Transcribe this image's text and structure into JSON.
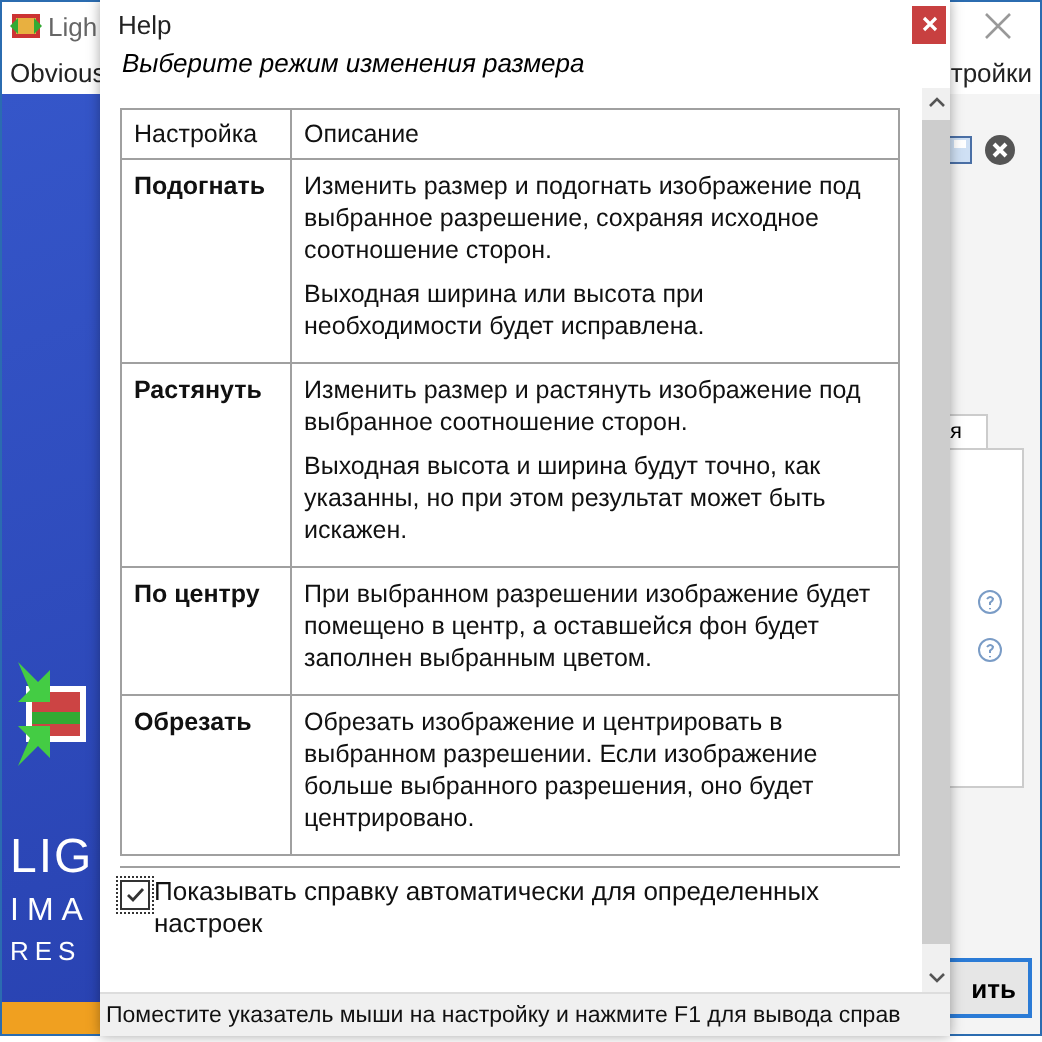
{
  "app": {
    "title": "Ligh",
    "menu_left": "Obvious",
    "menu_right": "тройки",
    "tab_fragment": "я",
    "logo_lines": [
      "LIG",
      "IMA",
      "RES"
    ],
    "button": "ить"
  },
  "dialog": {
    "title": "Help",
    "subtitle": "Выберите режим изменения размера",
    "table": {
      "columns": [
        "Настройка",
        "Описание"
      ],
      "rows": [
        {
          "setting": "Подогнать",
          "description": [
            "Изменить размер и подогнать изображение под выбранное разрешение, сохраняя исходное соотношение сторон.",
            "Выходная ширина или высота при необходимости будет исправлена."
          ]
        },
        {
          "setting": "Растянуть",
          "description": [
            "Изменить размер и растянуть изображение под выбранное соотношение сторон.",
            "Выходная высота и ширина будут точно, как указанны, но при этом результат может быть искажен."
          ]
        },
        {
          "setting": "По центру",
          "description": [
            "При выбранном разрешении изображение будет помещено в центр, а оставшейся фон будет заполнен выбранным цветом."
          ]
        },
        {
          "setting": "Обрезать",
          "description": [
            "Обрезать изображение и центрировать в выбранном разрешении. Если изображение больше выбранного разрешения, оно будет центрировано."
          ]
        }
      ]
    },
    "checkbox": {
      "label": "Показывать справку автоматически для определенных настроек",
      "checked": true
    },
    "status_text": "Поместите указатель мыши на настройку и нажмите F1 для вывода справ"
  }
}
